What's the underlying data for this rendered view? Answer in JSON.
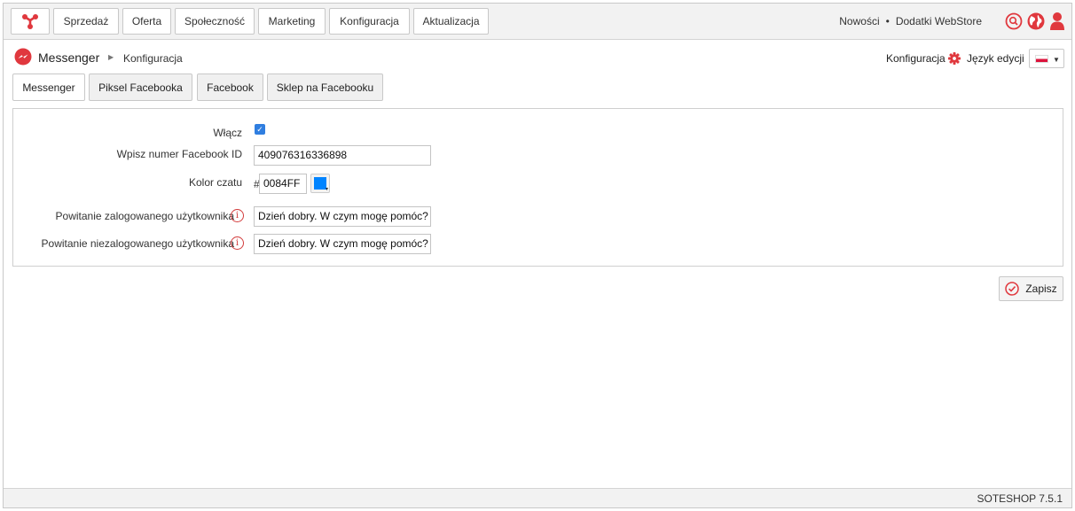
{
  "topbar": {
    "menu": [
      "Sprzedaż",
      "Oferta",
      "Społeczność",
      "Marketing",
      "Konfiguracja",
      "Aktualizacja"
    ],
    "news_link": "Nowości",
    "separator": "•",
    "addons_link": "Dodatki WebStore"
  },
  "breadcrumb": {
    "module": "Messenger",
    "separator": "▶",
    "current": "Konfiguracja"
  },
  "header_right": {
    "config_link": "Konfiguracja",
    "language_label": "Język edycji",
    "language_value": "Polski"
  },
  "tabs": [
    {
      "label": "Messenger",
      "active": true
    },
    {
      "label": "Piksel Facebooka",
      "active": false
    },
    {
      "label": "Facebook",
      "active": false
    },
    {
      "label": "Sklep na Facebooku",
      "active": false
    }
  ],
  "form": {
    "enable_label": "Włącz",
    "enabled": true,
    "facebook_id_label": "Wpisz numer Facebook ID",
    "facebook_id_value": "409076316336898",
    "color_label": "Kolor czatu",
    "color_hash": "#",
    "color_value": "0084FF",
    "color_swatch": "#0084ff",
    "logged_greeting_label": "Powitanie zalogowanego użytkownika",
    "logged_greeting_value": "Dzień dobry. W czym mogę pomóc?",
    "guest_greeting_label": "Powitanie niezalogowanego użytkownika",
    "guest_greeting_value": "Dzień dobry. W czym mogę pomóc?"
  },
  "actions": {
    "save_label": "Zapisz"
  },
  "footer": {
    "version": "SOTESHOP 7.5.1"
  },
  "colors": {
    "accent": "#e0383e",
    "checkbox": "#2f7ee0"
  }
}
